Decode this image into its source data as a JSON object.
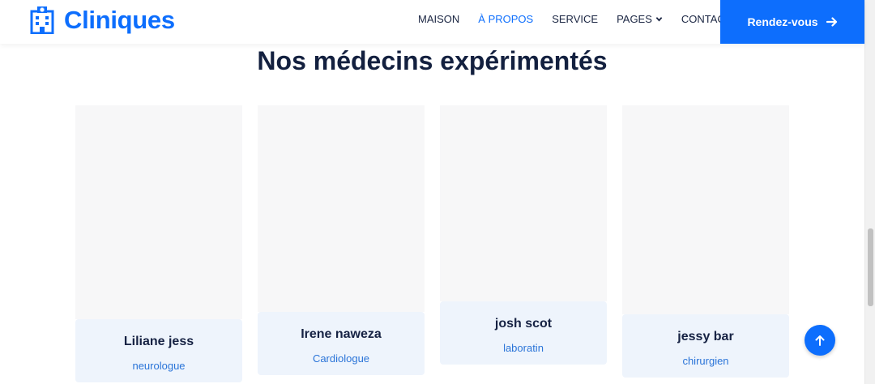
{
  "brand": {
    "name": "Cliniques",
    "icon": "hospital-icon"
  },
  "nav": {
    "items": [
      {
        "label": "MAISON",
        "active": false
      },
      {
        "label": "À PROPOS",
        "active": true
      },
      {
        "label": "SERVICE",
        "active": false
      },
      {
        "label": "PAGES",
        "active": false,
        "has_dropdown": true
      },
      {
        "label": "CONTACT",
        "active": false
      }
    ],
    "cta_label": "Rendez-vous",
    "cta_icon": "arrow-right-icon"
  },
  "section": {
    "title": "Nos médecins expérimentés"
  },
  "doctors": [
    {
      "name": "Liliane jess",
      "role": "neurologue",
      "scrub": "#1f7a5c",
      "skin": "#6b3f24",
      "hair": "#2a1a10"
    },
    {
      "name": "Irene naweza",
      "role": "Cardiologue",
      "scrub": "#7aa9d6",
      "skin": "#4a2a17",
      "hair": "#141010"
    },
    {
      "name": "josh scot",
      "role": "laboratin",
      "scrub": "#e9edf2",
      "skin": "#4f2f1c",
      "hair": "#141010"
    },
    {
      "name": "jessy bar",
      "role": "chirurgien",
      "scrub": "#2e6fc0",
      "skin": "#8a5a3a",
      "hair": "#2b1a12"
    }
  ],
  "colors": {
    "primary": "#0d6efd",
    "heading": "#13203f",
    "card_bg": "#eef4fc"
  },
  "back_to_top_icon": "arrow-up-icon"
}
